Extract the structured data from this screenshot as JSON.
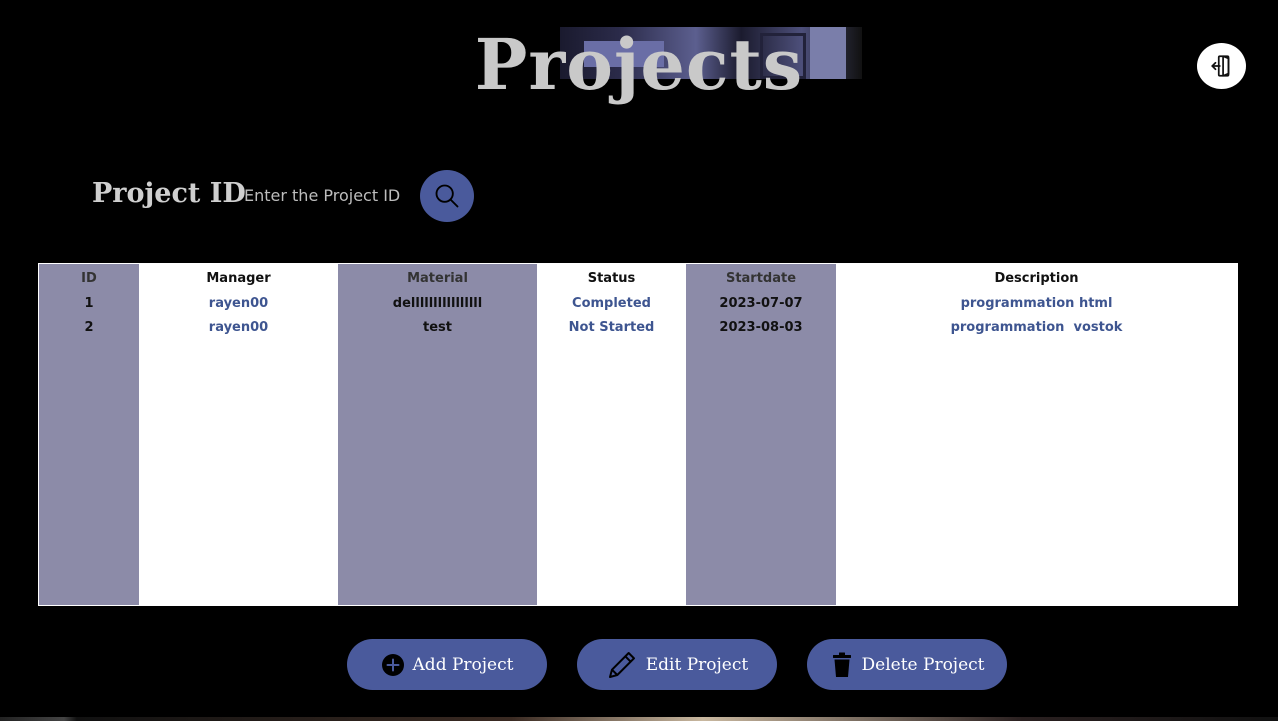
{
  "header": {
    "title": "Projects"
  },
  "icons": {
    "exit": "logout-door-icon",
    "search": "search-icon",
    "add": "plus-circle-icon",
    "edit": "pencil-icon",
    "delete": "trash-icon"
  },
  "colors": {
    "background": "#000000",
    "accent": "#4a5a9c",
    "shaded_column": "#8c8ba8",
    "link_text": "#3e5590"
  },
  "search": {
    "label": "Project ID",
    "placeholder": "Enter the Project ID",
    "value": ""
  },
  "table": {
    "columns": [
      "ID",
      "Manager",
      "Material",
      "Status",
      "Startdate",
      "Description"
    ],
    "rows": [
      {
        "id": "1",
        "manager": "rayen00",
        "material": "dellllllllllllllll",
        "status": "Completed",
        "startdate": "2023-07-07",
        "description": "programmation html"
      },
      {
        "id": "2",
        "manager": "rayen00",
        "material": "test",
        "status": "Not Started",
        "startdate": "2023-08-03",
        "description": "programmation  vostok"
      }
    ]
  },
  "actions": {
    "add_label": "Add Project",
    "edit_label": "Edit Project",
    "delete_label": "Delete Project"
  }
}
